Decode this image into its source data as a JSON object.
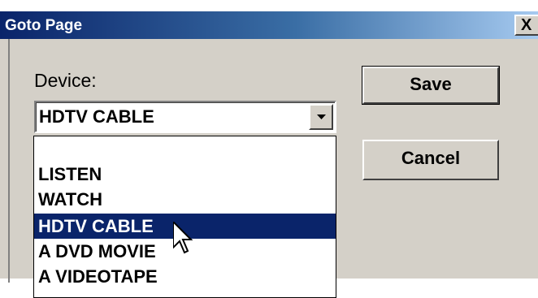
{
  "dialog": {
    "title": "Goto Page",
    "close_label": "X"
  },
  "device": {
    "label": "Device:",
    "selected_value": "HDTV CABLE",
    "options": [
      "",
      "LISTEN",
      "WATCH",
      "HDTV CABLE",
      "A DVD MOVIE",
      "A VIDEOTAPE"
    ],
    "highlighted_index": 3
  },
  "buttons": {
    "save_label": "Save",
    "cancel_label": "Cancel"
  },
  "colors": {
    "titlebar_start": "#0a246a",
    "titlebar_end": "#a6caf0",
    "dialog_bg": "#d4d0c8",
    "selection_bg": "#0a246a"
  },
  "icons": {
    "dropdown": "chevron-down-icon",
    "cursor": "mouse-pointer-icon"
  }
}
